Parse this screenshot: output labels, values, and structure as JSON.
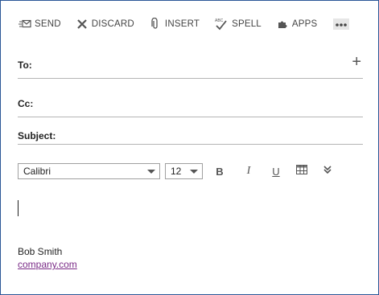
{
  "toolbar": {
    "send_label": "SEND",
    "discard_label": "DISCARD",
    "insert_label": "INSERT",
    "spell_label": "SPELL",
    "apps_label": "APPS",
    "more_icon": "ellipsis-icon"
  },
  "fields": {
    "to_label": "To:",
    "cc_label": "Cc:",
    "subject_label": "Subject:"
  },
  "format": {
    "font_name": "Calibri",
    "font_size": "12",
    "bold": "B",
    "italic": "I",
    "underline": "U"
  },
  "signature": {
    "name": "Bob Smith",
    "link": "company.com"
  },
  "colors": {
    "border": "#2b5797",
    "link": "#7a2b87"
  }
}
